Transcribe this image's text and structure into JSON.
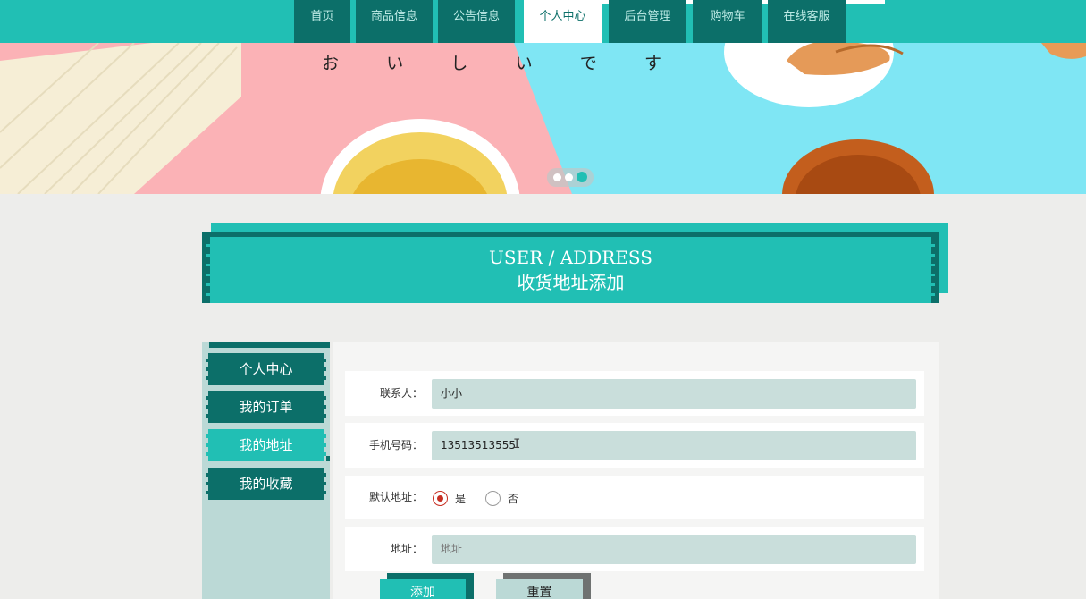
{
  "nav": {
    "items": [
      {
        "label": "首页"
      },
      {
        "label": "商品信息"
      },
      {
        "label": "公告信息"
      },
      {
        "label": "个人中心",
        "active": true
      },
      {
        "label": "后台管理"
      },
      {
        "label": "购物车"
      },
      {
        "label": "在线客服"
      }
    ]
  },
  "banner": {
    "caption": [
      "お",
      "い",
      "し",
      "い",
      "で",
      "す"
    ],
    "slide_count": 3,
    "active_slide": 3
  },
  "section": {
    "title_en": "USER / ADDRESS",
    "title_cn": "收货地址添加"
  },
  "side_menu": {
    "items": [
      {
        "label": "个人中心"
      },
      {
        "label": "我的订单"
      },
      {
        "label": "我的地址",
        "active": true
      },
      {
        "label": "我的收藏"
      }
    ]
  },
  "form": {
    "contact": {
      "label": "联系人：",
      "value": "小小"
    },
    "phone": {
      "label": "手机号码：",
      "value": "13513513555"
    },
    "default": {
      "label": "默认地址：",
      "options": [
        "是",
        "否"
      ],
      "selected": "是"
    },
    "address": {
      "label": "地址：",
      "value": "",
      "placeholder": "地址"
    },
    "submit_label": "添加",
    "reset_label": "重置"
  },
  "colors": {
    "primary": "#21bfb4",
    "dark": "#0c6f69",
    "side_bg": "#bbd9d6",
    "input_bg": "#c9dedb",
    "radio_checked": "#c72f23",
    "page_bg": "#ededeb"
  }
}
